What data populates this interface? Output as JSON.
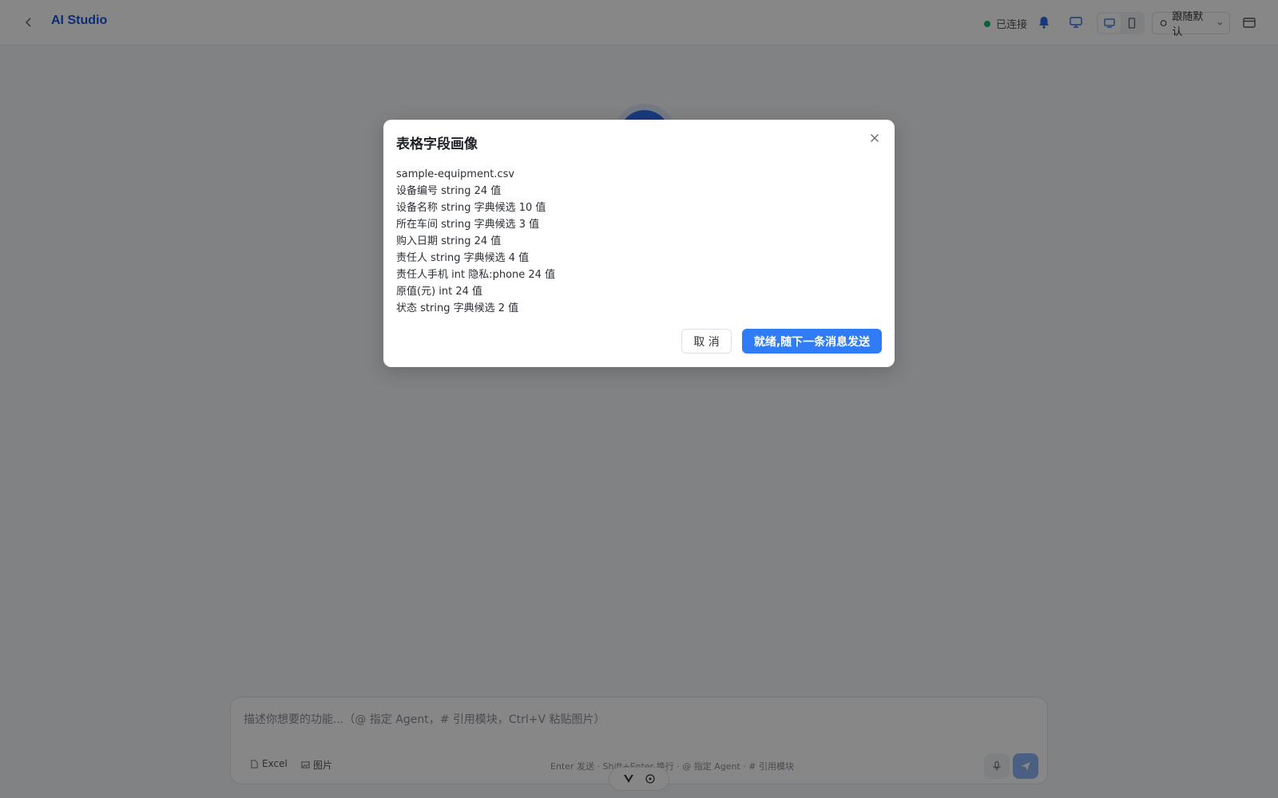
{
  "header": {
    "title": "AI Studio",
    "status_label": "已连接",
    "theme_label": "跟随默认"
  },
  "composer": {
    "placeholder": "描述你想要的功能...（@ 指定 Agent，# 引用模块，Ctrl+V 粘贴图片）",
    "attach_excel": "Excel",
    "attach_image": "图片",
    "hint": "Enter 发送 · Shift+Enter 换行 · @ 指定 Agent · # 引用模块"
  },
  "modal": {
    "title": "表格字段画像",
    "rows": [
      "sample-equipment.csv",
      "设备编号 string 24 值",
      "设备名称 string 字典候选 10 值",
      "所在车间 string 字典候选 3 值",
      "购入日期 string 24 值",
      "责任人 string 字典候选 4 值",
      "责任人手机 int 隐私:phone 24 值",
      "原值(元) int 24 值",
      "状态 string 字典候选 2 值"
    ],
    "cancel_label": "取 消",
    "confirm_label": "就绪,随下一条消息发送"
  },
  "colors": {
    "accent": "#2f7cf6",
    "brand": "#1a56db",
    "status_ok": "#12b76a"
  }
}
